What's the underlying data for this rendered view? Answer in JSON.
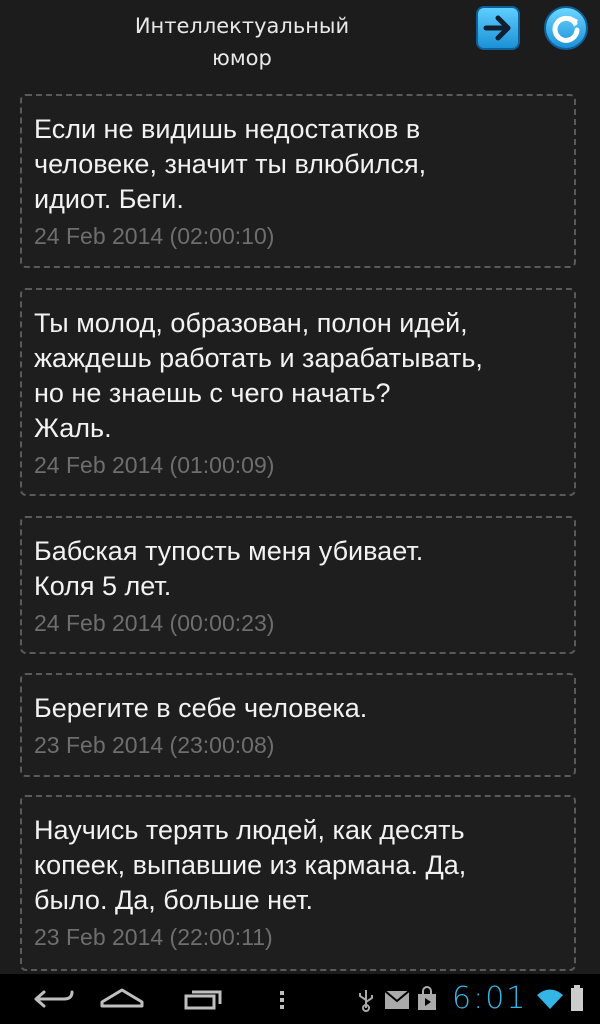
{
  "header": {
    "title": "Интеллектуальный\nюмор",
    "next_icon": "arrow-right-icon",
    "refresh_icon": "refresh-icon",
    "accent": "#33b5e5"
  },
  "posts": [
    {
      "text": "Если не видишь недостатков в\nчеловеке, значит ты влюбился,\nидиот. Беги.",
      "date": "24 Feb 2014 (02:00:10)"
    },
    {
      "text": "Ты молод, образован, полон идей,\nжаждешь работать и зарабатывать,\nно не знаешь с чего начать?\nЖаль.",
      "date": "24 Feb 2014 (01:00:09)"
    },
    {
      "text": "Бабская тупость меня убивает.\nКоля 5 лет.",
      "date": "24 Feb 2014 (00:00:23)"
    },
    {
      "text": "Берегите в себе человека.",
      "date": "23 Feb 2014 (23:00:08)"
    },
    {
      "text": "Научись терять людей, как десять\nкопеек, выпавшие из кармана. Да,\nбыло. Да, больше нет.",
      "date": "23 Feb 2014 (22:00:11)"
    }
  ],
  "navbar": {
    "back_icon": "back-icon",
    "home_icon": "home-icon",
    "recents_icon": "recent-apps-icon",
    "menu_icon": "menu-dots-icon",
    "status_icons": [
      "usb-icon",
      "gmail-icon",
      "shop-icon"
    ],
    "clock": "6:01",
    "wifi_icon": "wifi-icon",
    "battery_icon": "battery-icon"
  }
}
